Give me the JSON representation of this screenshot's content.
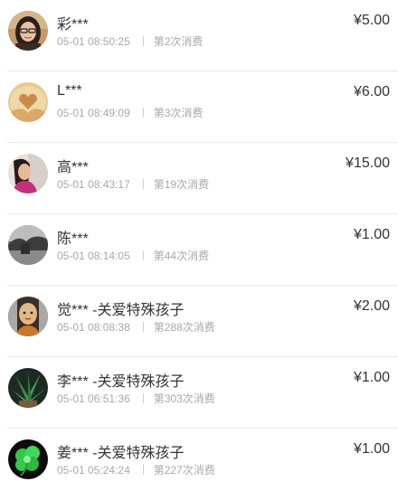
{
  "currency_symbol": "¥",
  "records": [
    {
      "name": "彩***",
      "time": "05-01 08:50:25",
      "count_text": "第2次消费",
      "amount": "5.00",
      "avatar_icon": "woman-glasses-avatar-icon"
    },
    {
      "name": "L***",
      "time": "05-01 08:49:09",
      "count_text": "第3次消费",
      "amount": "6.00",
      "avatar_icon": "heart-hands-avatar-icon"
    },
    {
      "name": "高***",
      "time": "05-01 08:43:17",
      "count_text": "第19次消费",
      "amount": "15.00",
      "avatar_icon": "woman-pink-avatar-icon"
    },
    {
      "name": "陈***",
      "time": "05-01 08:14:05",
      "count_text": "第44次消费",
      "amount": "1.00",
      "avatar_icon": "landscape-avatar-icon"
    },
    {
      "name": "觉*** -关爱特殊孩子",
      "time": "05-01 08:08:38",
      "count_text": "第288次消费",
      "amount": "2.00",
      "avatar_icon": "monk-avatar-icon"
    },
    {
      "name": "李*** -关爱特殊孩子",
      "time": "05-01 06:51:36",
      "count_text": "第303次消费",
      "amount": "1.00",
      "avatar_icon": "plant-avatar-icon"
    },
    {
      "name": "姜*** -关爱特殊孩子",
      "time": "05-01 05:24:24",
      "count_text": "第227次消费",
      "amount": "1.00",
      "avatar_icon": "green-clover-avatar-icon"
    }
  ]
}
